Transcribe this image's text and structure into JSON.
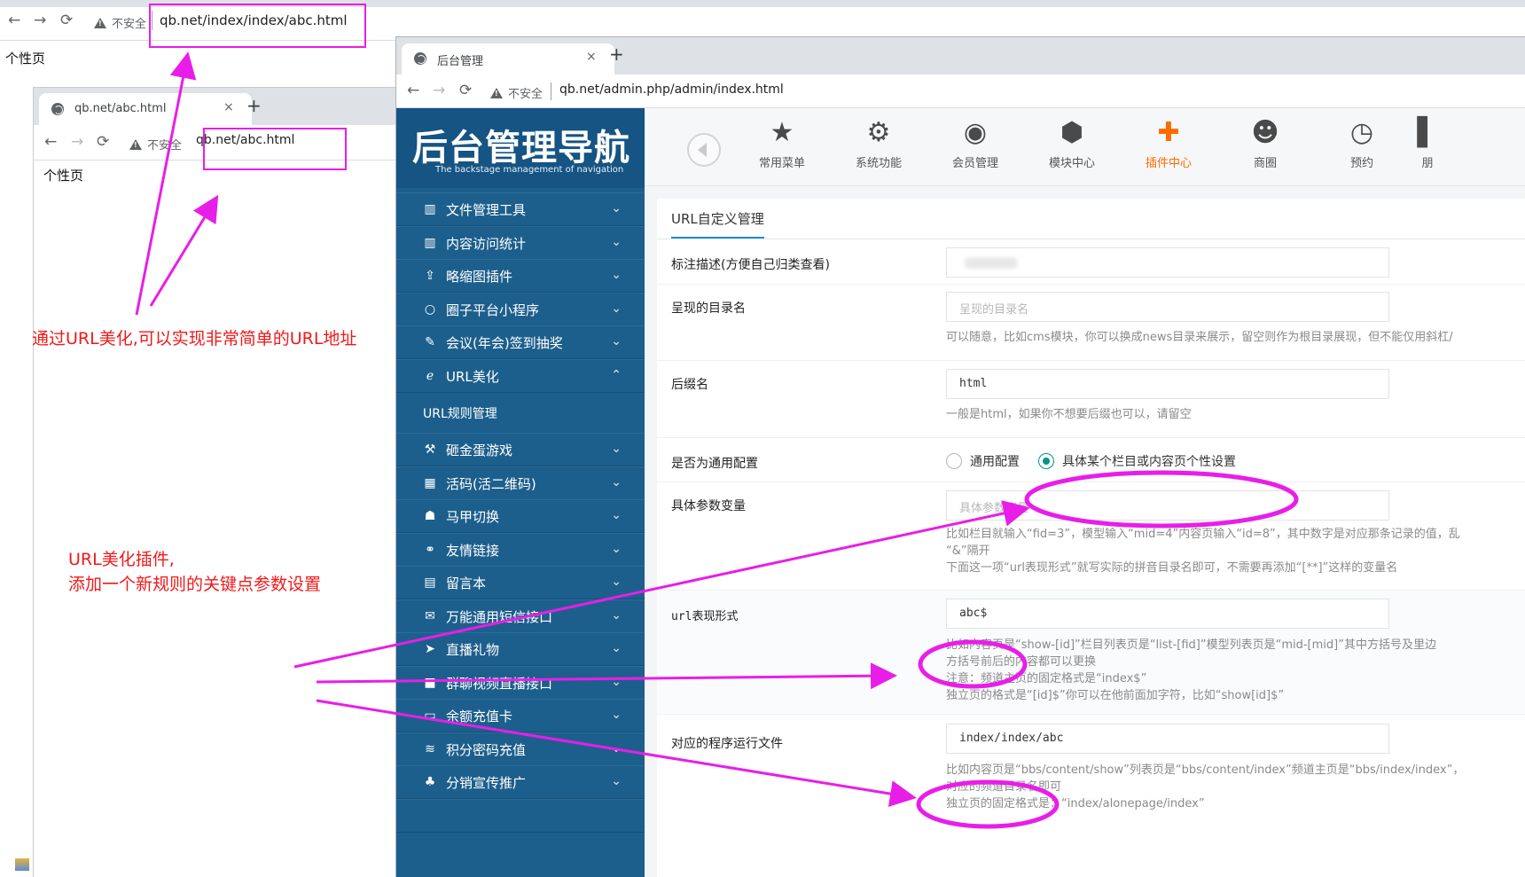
{
  "window_back": {
    "nav": {
      "back": "←",
      "forward": "→",
      "reload": "⟳"
    },
    "security_label": "不安全",
    "url": "qb.net/index/index/abc.html",
    "body_text": "个性页"
  },
  "window_middle": {
    "tab_title": "qb.net/abc.html",
    "tab_close": "×",
    "new_tab": "+",
    "nav": {
      "back": "←",
      "forward": "→",
      "reload": "⟳"
    },
    "security_label": "不安全",
    "url": "qb.net/abc.html",
    "body_text": "个性页"
  },
  "window_front": {
    "tab_title": "后台管理",
    "tab_close": "×",
    "new_tab": "+",
    "nav": {
      "back": "←",
      "forward": "→",
      "reload": "⟳"
    },
    "security_label": "不安全",
    "url": "qb.net/admin.php/admin/index.html"
  },
  "sidebar": {
    "logo_title": "后台管理导航",
    "logo_subtitle": "The backstage management of navigation",
    "items": [
      {
        "icon": "▥",
        "label": "文件管理工具",
        "chevron": "⌄"
      },
      {
        "icon": "▥",
        "label": "内容访问统计",
        "chevron": "⌄"
      },
      {
        "icon": "⇪",
        "label": "略缩图插件",
        "chevron": "⌄"
      },
      {
        "icon": "○",
        "label": "圈子平台小程序",
        "chevron": "⌄"
      },
      {
        "icon": "✎",
        "label": "会议(年会)签到抽奖",
        "chevron": "⌄"
      },
      {
        "icon": "ℯ",
        "label": "URL美化",
        "chevron": "⌃"
      },
      {
        "icon": "⚒",
        "label": "砸金蛋游戏",
        "chevron": "⌄"
      },
      {
        "icon": "▦",
        "label": "活码(活二维码)",
        "chevron": "⌄"
      },
      {
        "icon": "☗",
        "label": "马甲切换",
        "chevron": "⌄"
      },
      {
        "icon": "⚭",
        "label": "友情链接",
        "chevron": "⌄"
      },
      {
        "icon": "▤",
        "label": "留言本",
        "chevron": "⌄"
      },
      {
        "icon": "✉",
        "label": "万能通用短信接口",
        "chevron": "⌄"
      },
      {
        "icon": "➤",
        "label": "直播礼物",
        "chevron": "⌄"
      },
      {
        "icon": "■",
        "label": "群聊视频直播接口",
        "chevron": "⌄"
      },
      {
        "icon": "▭",
        "label": "余额充值卡",
        "chevron": "⌄"
      },
      {
        "icon": "≋",
        "label": "积分密码充值",
        "chevron": "⌄"
      },
      {
        "icon": "♣",
        "label": "分销宣传推广",
        "chevron": "⌄"
      }
    ],
    "subitem": "URL规则管理"
  },
  "topnav": {
    "items": [
      {
        "icon": "★",
        "label": "常用菜单"
      },
      {
        "icon": "⚙",
        "label": "系统功能"
      },
      {
        "icon": "◉",
        "label": "会员管理"
      },
      {
        "icon": "⬢",
        "label": "模块中心"
      },
      {
        "icon": "✚",
        "label": "插件中心"
      },
      {
        "icon": "☻",
        "label": "商圈"
      },
      {
        "icon": "◷",
        "label": "预约"
      },
      {
        "icon": "▌",
        "label": "朋"
      }
    ]
  },
  "form": {
    "title": "URL自定义管理",
    "rows": [
      {
        "label": "标注描述(方便自己归类查看)",
        "value": "",
        "placeholder": "",
        "help": []
      },
      {
        "label": "呈现的目录名",
        "value": "",
        "placeholder": "呈现的目录名",
        "help": [
          "可以随意，比如cms模块，你可以换成news目录来展示，留空则作为根目录展现，但不能仅用斜杠/"
        ]
      },
      {
        "label": "后缀名",
        "value": "html",
        "placeholder": "",
        "help": [
          "一般是html，如果你不想要后缀也可以，请留空"
        ]
      },
      {
        "label": "是否为通用配置",
        "radios": [
          "通用配置",
          "具体某个栏目或内容页个性设置"
        ]
      },
      {
        "label": "具体参数变量",
        "value": "",
        "placeholder": "具体参数变量",
        "help": [
          "比如栏目就输入“fid=3”，模型输入“mid=4”内容页输入“id=8”，其中数字是对应那条记录的值，乱",
          "“&”隔开",
          "下面这一项“url表现形式”就写实际的拼音目录名即可，不需要再添加“[**]”这样的变量名"
        ]
      },
      {
        "label": "url表现形式",
        "value": "abc$",
        "placeholder": "",
        "help": [
          "比如内容页是“show-[id]”栏目列表页是“list-[fid]”模型列表页是“mid-[mid]”其中方括号及里边",
          "方括号前后的内容都可以更换",
          "注意：频道主页的固定格式是“index$”",
          "独立页的格式是“[id]$”你可以在他前面加字符，比如“show[id]$”"
        ]
      },
      {
        "label": "对应的程序运行文件",
        "value": "index/index/abc",
        "placeholder": "",
        "help": [
          "比如内容页是“bbs/content/show”列表页是“bbs/content/index”频道主页是“bbs/index/index”，",
          "对应的频道目录名即可",
          "独立页的固定格式是：“index/alonepage/index”"
        ]
      }
    ]
  },
  "annotations": {
    "text1": "通过URL美化,可以实现非常简单的URL地址",
    "text2_line1": "URL美化插件,",
    "text2_line2": "添加一个新规则的关键点参数设置",
    "color_text": "#f21818",
    "color_mark": "#e81ee8"
  }
}
